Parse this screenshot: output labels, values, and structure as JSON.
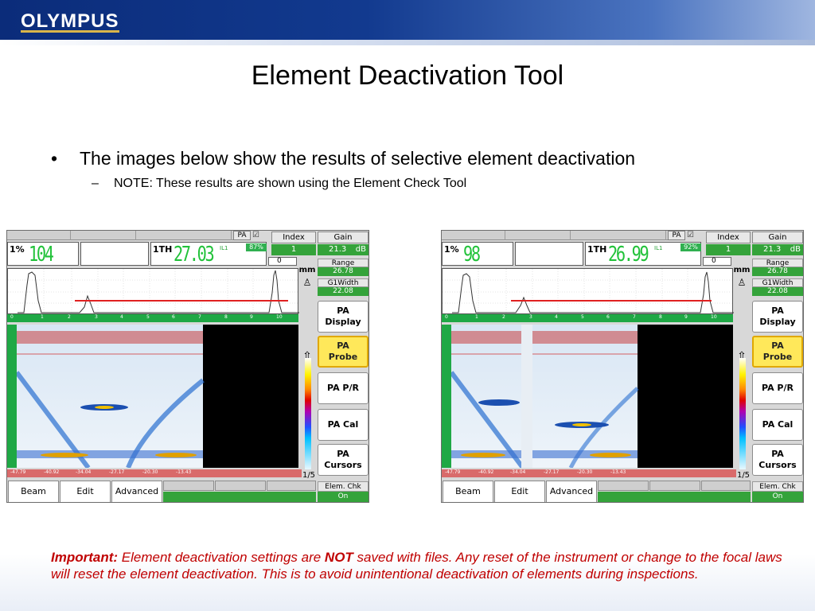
{
  "brand": {
    "logo_text": "OLYMPUS"
  },
  "slide": {
    "title": "Element Deactivation Tool",
    "bullet": "The images below show the results of selective element deactivation",
    "bullet_marker": "•",
    "sub_bullet": "NOTE: These results are shown using the Element Check Tool",
    "sub_bullet_marker": "–",
    "note": {
      "lead": "Important:",
      "part1": " Element deactivation settings are ",
      "emphasis": "NOT",
      "part2": " saved with files.  Any reset of the instrument or change to the focal laws will reset the element deactivation.  This is to avoid unintentional deactivation of elements during inspections."
    }
  },
  "panels": {
    "left": {
      "amp_label": "1%",
      "amp_value": "104",
      "th_label": "1TH",
      "th_value": "27.03",
      "il_label": "IL1",
      "pct_badge": "87%"
    },
    "right": {
      "amp_label": "1%",
      "amp_value": "98",
      "th_label": "1TH",
      "th_value": "26.99",
      "il_label": "IL1",
      "pct_badge": "92%"
    },
    "shared": {
      "pa_tab": "PA",
      "index_header": "Index",
      "index_value": "1",
      "gain_header": "Gain",
      "gain_value": "21.3",
      "gain_unit": "dB",
      "zero_value": "0",
      "range_label": "Range",
      "range_value": "26.78",
      "gwidth_label": "G1Width",
      "gwidth_value": "22.08",
      "units_label": "mm",
      "page_indicator": "1/5",
      "menu": [
        "PA\nDisplay",
        "PA\nProbe",
        "PA P/R",
        "PA Cal",
        "PA\nCursors"
      ],
      "elem_label": "Elem. Chk",
      "elem_value": "On",
      "bottom_tabs": [
        "Beam",
        "Edit",
        "Advanced"
      ],
      "ascan_ticks": [
        "0",
        "1",
        "2",
        "3",
        "4",
        "5",
        "6",
        "7",
        "8",
        "9",
        "10"
      ],
      "bscan_ticks": [
        "-47.79",
        "-40.92",
        "-34.04",
        "-27.17",
        "-20.30",
        "-13.43"
      ]
    }
  }
}
